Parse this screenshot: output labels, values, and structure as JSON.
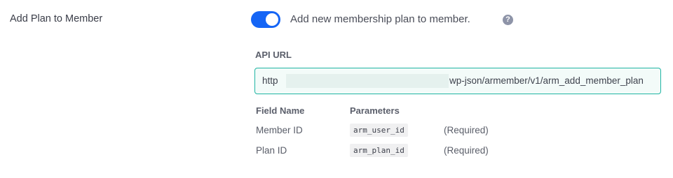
{
  "setting": {
    "label": "Add Plan to Member",
    "toggle_on": true,
    "toggle_label": "Add new membership plan to member.",
    "help_glyph": "?"
  },
  "api": {
    "heading": "API URL",
    "url_prefix": "http",
    "url_suffix": "wp-json/armember/v1/arm_add_member_plan"
  },
  "params": {
    "col_field": "Field Name",
    "col_params": "Parameters",
    "rows": [
      {
        "field": "Member ID",
        "param": "arm_user_id",
        "note": "(Required)"
      },
      {
        "field": "Plan ID",
        "param": "arm_plan_id",
        "note": "(Required)"
      }
    ]
  },
  "colors": {
    "toggle_accent": "#1565f5",
    "url_border": "#1fb5a3"
  }
}
